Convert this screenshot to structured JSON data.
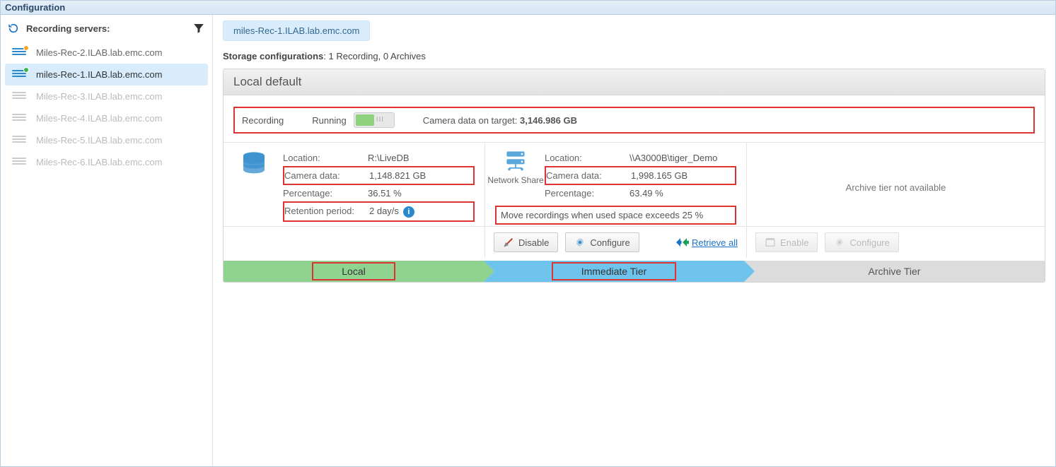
{
  "window": {
    "title": "Configuration"
  },
  "sidebar": {
    "header": "Recording servers:",
    "servers": [
      {
        "name": "Miles-Rec-2.ILAB.lab.emc.com",
        "status": "warning",
        "selected": false,
        "dim": false
      },
      {
        "name": "miles-Rec-1.ILAB.lab.emc.com",
        "status": "ok",
        "selected": true,
        "dim": false
      },
      {
        "name": "Miles-Rec-3.ILAB.lab.emc.com",
        "status": "none",
        "selected": false,
        "dim": true
      },
      {
        "name": "Miles-Rec-4.ILAB.lab.emc.com",
        "status": "none",
        "selected": false,
        "dim": true
      },
      {
        "name": "Miles-Rec-5.ILAB.lab.emc.com",
        "status": "none",
        "selected": false,
        "dim": true
      },
      {
        "name": "Miles-Rec-6.ILAB.lab.emc.com",
        "status": "none",
        "selected": false,
        "dim": true
      }
    ]
  },
  "main": {
    "breadcrumb": "miles-Rec-1.ILAB.lab.emc.com",
    "storage_line_label": "Storage configurations",
    "storage_line_value": "1 Recording, 0 Archives",
    "panel_title": "Local default",
    "status": {
      "label": "Recording",
      "state": "Running",
      "camera_target_label": "Camera data on target:",
      "camera_target_value": "3,146.986 GB"
    },
    "local": {
      "location_label": "Location:",
      "location_value": "R:\\LiveDB",
      "camera_label": "Camera data:",
      "camera_value": "1,148.821 GB",
      "pct_label": "Percentage:",
      "pct_value": "36.51 %",
      "ret_label": "Retention period:",
      "ret_value": "2 day/s"
    },
    "immediate": {
      "caption": "Network Share",
      "location_label": "Location:",
      "location_value": "\\\\A3000B\\tiger_Demo",
      "camera_label": "Camera data:",
      "camera_value": "1,998.165 GB",
      "pct_label": "Percentage:",
      "pct_value": "63.49 %",
      "move_note": "Move recordings when used space exceeds 25 %"
    },
    "archive": {
      "na_text": "Archive tier not available"
    },
    "actions": {
      "disable": "Disable",
      "configure": "Configure",
      "retrieve": "Retrieve all",
      "enable": "Enable"
    },
    "tiers": {
      "local": "Local",
      "immediate": "Immediate Tier",
      "archive": "Archive Tier"
    }
  }
}
